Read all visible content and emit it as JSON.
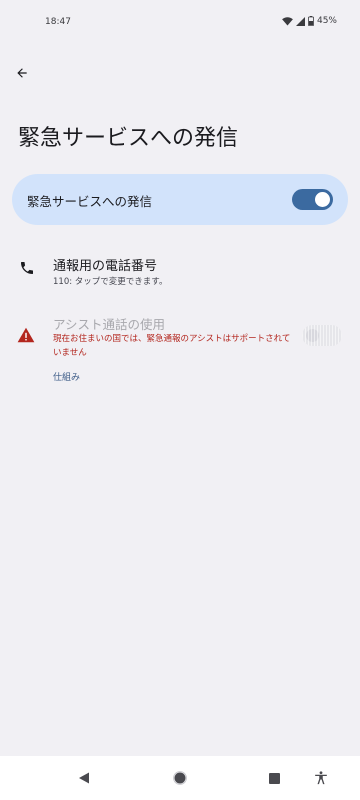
{
  "status_bar": {
    "time": "18:47",
    "battery": "45%"
  },
  "page": {
    "title": "緊急サービスへの発信"
  },
  "main_switch": {
    "label": "緊急サービスへの発信",
    "enabled": true
  },
  "phone_number_setting": {
    "title": "通報用の電話番号",
    "summary": "110: タップで変更できます。"
  },
  "assisted_call": {
    "title": "アシスト通話の使用",
    "warning": "現在お住まいの国では、緊急通報のアシストはサポートされていません",
    "enabled": false
  },
  "learn_more": {
    "label": "仕組み"
  },
  "colors": {
    "background": "#f1f0f4",
    "accent": "#3b6aa0",
    "card": "#d2e3fb",
    "error": "#b3261e"
  },
  "icons": {
    "back": "arrow-back-icon",
    "phone": "phone-icon",
    "warning": "warning-icon",
    "nav_back": "triangle-back-icon",
    "nav_home": "circle-home-icon",
    "nav_recents": "square-recents-icon",
    "nav_accessibility": "accessibility-icon"
  }
}
